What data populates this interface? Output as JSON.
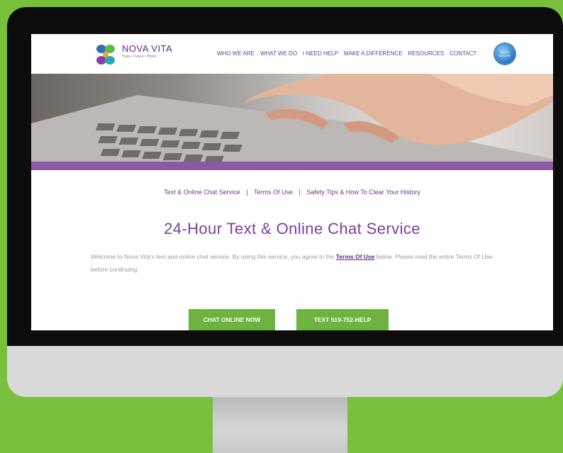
{
  "brand": {
    "name": "NOVA VITA",
    "tagline": "Hope • Peace • Home",
    "colors": {
      "purple": "#7a3f9b",
      "green": "#6db33f",
      "background": "#78c03c"
    }
  },
  "nav": {
    "items": [
      {
        "label": "WHO WE ARE"
      },
      {
        "label": "WHAT WE DO"
      },
      {
        "label": "I NEED HELP"
      },
      {
        "label": "MAKE A DIFFERENCE"
      },
      {
        "label": "RESOURCES"
      },
      {
        "label": "CONTACT"
      }
    ],
    "safe_exit": {
      "line1": "QUICK",
      "line2": "ESCAPE"
    }
  },
  "subnav": {
    "link1": "Text & Online Chat Service",
    "link2": "Terms Of Use",
    "link3": "Safety Tips & How To Clear Your History",
    "separator": "|"
  },
  "main": {
    "title": "24-Hour Text & Online Chat Service",
    "intro_before": "Welcome to Nova Vita's text and online chat service. By using this service, you agree to the ",
    "intro_link": "Terms Of Use",
    "intro_after": " below. Please read the entire Terms Of Use before continuing.",
    "chat_button": "CHAT ONLINE NOW",
    "text_button": "TEXT 519-752-HELP"
  }
}
